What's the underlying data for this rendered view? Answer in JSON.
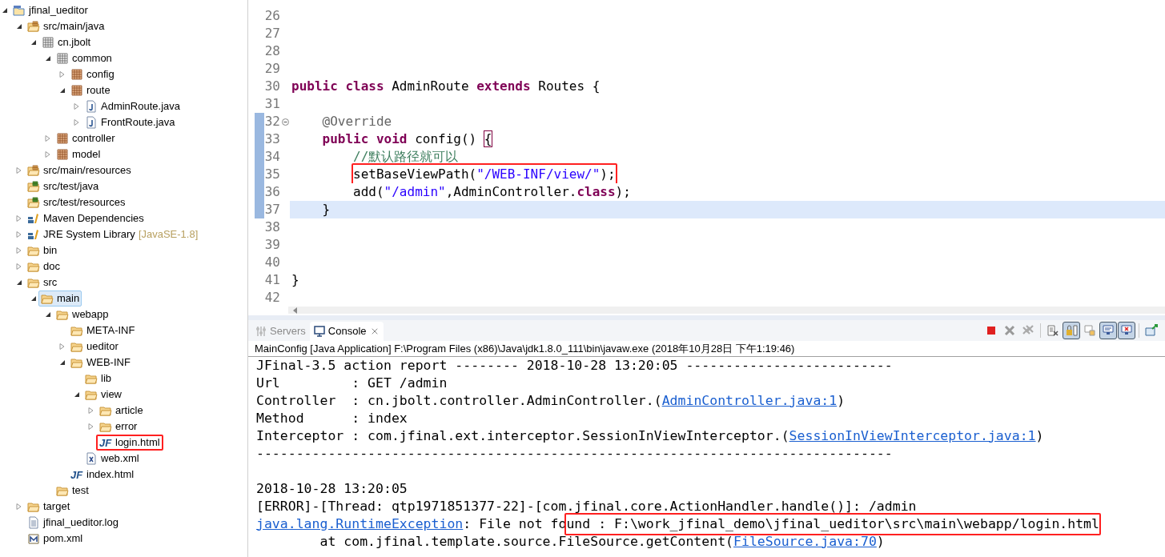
{
  "project_tree": [
    {
      "label": "jfinal_ueditor",
      "kind": "project",
      "expanded": true,
      "selected": false,
      "children": [
        {
          "label": "src/main/java",
          "kind": "source-folder",
          "expanded": true,
          "selected": false,
          "children": [
            {
              "label": "cn.jbolt",
              "kind": "package-empty",
              "expanded": true,
              "selected": false,
              "children": [
                {
                  "label": "common",
                  "kind": "package-empty",
                  "expanded": true,
                  "selected": false,
                  "children": [
                    {
                      "label": "config",
                      "kind": "package",
                      "expanded": false,
                      "selected": false
                    },
                    {
                      "label": "route",
                      "kind": "package",
                      "expanded": true,
                      "selected": false,
                      "children": [
                        {
                          "label": "AdminRoute.java",
                          "kind": "java",
                          "expanded": false,
                          "selected": false
                        },
                        {
                          "label": "FrontRoute.java",
                          "kind": "java",
                          "expanded": false,
                          "selected": false
                        }
                      ]
                    }
                  ]
                },
                {
                  "label": "controller",
                  "kind": "package",
                  "expanded": false,
                  "selected": false
                },
                {
                  "label": "model",
                  "kind": "package",
                  "expanded": false,
                  "selected": false
                }
              ]
            }
          ]
        },
        {
          "label": "src/main/resources",
          "kind": "source-folder",
          "expanded": false,
          "selected": false
        },
        {
          "label": "src/test/java",
          "kind": "test-folder",
          "selected": false
        },
        {
          "label": "src/test/resources",
          "kind": "test-folder",
          "selected": false
        },
        {
          "label": "Maven Dependencies",
          "kind": "library",
          "expanded": false,
          "selected": false
        },
        {
          "label": "JRE System Library",
          "decoration": "[JavaSE-1.8]",
          "kind": "library",
          "expanded": false,
          "selected": false
        },
        {
          "label": "bin",
          "kind": "folder",
          "expanded": false,
          "selected": false
        },
        {
          "label": "doc",
          "kind": "folder",
          "expanded": false,
          "selected": false
        },
        {
          "label": "src",
          "kind": "folder",
          "expanded": true,
          "selected": false,
          "children": [
            {
              "label": "main",
              "kind": "folder",
              "expanded": true,
              "selected": true,
              "children": [
                {
                  "label": "webapp",
                  "kind": "folder",
                  "expanded": true,
                  "selected": false,
                  "children": [
                    {
                      "label": "META-INF",
                      "kind": "folder",
                      "selected": false
                    },
                    {
                      "label": "ueditor",
                      "kind": "folder",
                      "expanded": false,
                      "selected": false
                    },
                    {
                      "label": "WEB-INF",
                      "kind": "folder",
                      "expanded": true,
                      "selected": false,
                      "children": [
                        {
                          "label": "lib",
                          "kind": "folder",
                          "selected": false
                        },
                        {
                          "label": "view",
                          "kind": "folder",
                          "expanded": true,
                          "selected": false,
                          "children": [
                            {
                              "label": "article",
                              "kind": "folder",
                              "expanded": false,
                              "selected": false
                            },
                            {
                              "label": "error",
                              "kind": "folder",
                              "expanded": false,
                              "selected": false
                            },
                            {
                              "label": "login.html",
                              "kind": "jf",
                              "icon_text": "JF",
                              "selected": false,
                              "boxed": true
                            }
                          ]
                        },
                        {
                          "label": "web.xml",
                          "kind": "xml",
                          "selected": false
                        }
                      ]
                    },
                    {
                      "label": "index.html",
                      "kind": "jf",
                      "icon_text": "JF",
                      "selected": false
                    }
                  ]
                },
                {
                  "label": "test",
                  "kind": "folder",
                  "selected": false
                }
              ]
            }
          ]
        },
        {
          "label": "target",
          "kind": "folder",
          "expanded": false,
          "selected": false
        },
        {
          "label": "jfinal_ueditor.log",
          "kind": "text-file",
          "selected": false
        },
        {
          "label": "pom.xml",
          "kind": "maven-file",
          "selected": false
        }
      ]
    }
  ],
  "editor": {
    "lines": [
      {
        "number": "26",
        "current": false,
        "changed": false
      },
      {
        "number": "27",
        "current": false,
        "changed": false
      },
      {
        "number": "28",
        "current": false,
        "changed": false
      },
      {
        "number": "29",
        "current": false,
        "changed": false
      },
      {
        "number": "30",
        "current": false,
        "changed": false,
        "tokens": [
          {
            "kind": "keyword",
            "text": "public class "
          },
          {
            "kind": "plain",
            "text": "AdminRoute "
          },
          {
            "kind": "keyword",
            "text": "extends "
          },
          {
            "kind": "plain",
            "text": "Routes {"
          }
        ]
      },
      {
        "number": "31",
        "current": false,
        "changed": false
      },
      {
        "number": "32",
        "current": false,
        "changed": true,
        "folded": false,
        "tokens": [
          {
            "kind": "annotation",
            "text": "    @Override"
          }
        ]
      },
      {
        "number": "33",
        "current": false,
        "changed": true,
        "tokens": [
          {
            "kind": "keyword",
            "text": "    public void "
          },
          {
            "kind": "plain",
            "text": "config() "
          },
          {
            "kind": "matched",
            "text": "{"
          }
        ]
      },
      {
        "number": "34",
        "current": false,
        "changed": true,
        "tokens": [
          {
            "kind": "comment",
            "text": "        //默认路径就可以"
          }
        ]
      },
      {
        "number": "35",
        "current": false,
        "changed": true,
        "tokens": [
          {
            "kind": "plain",
            "text": "setBaseViewPath(",
            "boxed": true
          },
          {
            "kind": "string",
            "text": "\"/WEB-INF/view/\"",
            "boxed": true
          },
          {
            "kind": "plain",
            "text": ");",
            "boxed": true
          }
        ]
      },
      {
        "number": "36",
        "current": false,
        "changed": true,
        "tokens": [
          {
            "kind": "plain",
            "text": "        add("
          },
          {
            "kind": "string",
            "text": "\"/admin\""
          },
          {
            "kind": "plain",
            "text": ",AdminController."
          },
          {
            "kind": "keyword",
            "text": "class"
          },
          {
            "kind": "plain",
            "text": ");"
          }
        ]
      },
      {
        "number": "37",
        "current": true,
        "changed": true,
        "tokens": [
          {
            "kind": "plain",
            "text": "    }"
          }
        ]
      },
      {
        "number": "38",
        "current": false,
        "changed": false
      },
      {
        "number": "39",
        "current": false,
        "changed": false
      },
      {
        "number": "40",
        "current": false,
        "changed": false
      },
      {
        "number": "41",
        "current": false,
        "changed": false,
        "tokens": [
          {
            "kind": "plain",
            "text": "}"
          }
        ]
      },
      {
        "number": "42",
        "current": false,
        "changed": false
      }
    ]
  },
  "console": {
    "tabs": [
      {
        "label": "Servers",
        "kind": "servers",
        "selected": false,
        "closable": false
      },
      {
        "label": "Console",
        "kind": "console",
        "selected": true,
        "closable": true
      }
    ],
    "toolbar": [
      {
        "kind": "terminate",
        "pressed": false
      },
      {
        "kind": "remove",
        "pressed": false
      },
      {
        "kind": "remove-all",
        "pressed": false
      },
      {
        "kind": "separator"
      },
      {
        "kind": "clear",
        "pressed": false
      },
      {
        "kind": "scroll-lock",
        "pressed": true
      },
      {
        "kind": "word-wrap",
        "pressed": false
      },
      {
        "kind": "show-stdout",
        "pressed": true
      },
      {
        "kind": "show-stderr",
        "pressed": true
      },
      {
        "kind": "separator"
      },
      {
        "kind": "pin",
        "pressed": false
      }
    ],
    "process": "MainConfig [Java Application] F:\\Program Files (x86)\\Java\\jdk1.8.0_111\\bin\\javaw.exe (2018年10月28日 下午1:19:46)",
    "lines": [
      {
        "kind": "text",
        "segments": [
          {
            "kind": "plain",
            "text": "JFinal-3.5 action report -------- 2018-10-28 13:20:05 --------------------------"
          }
        ]
      },
      {
        "kind": "text",
        "segments": [
          {
            "kind": "plain",
            "text": "Url         : GET /admin"
          }
        ]
      },
      {
        "kind": "text",
        "segments": [
          {
            "kind": "plain",
            "text": "Controller  : cn.jbolt.controller.AdminController.("
          },
          {
            "kind": "link",
            "text": "AdminController.java:1"
          },
          {
            "kind": "plain",
            "text": ")"
          }
        ]
      },
      {
        "kind": "text",
        "segments": [
          {
            "kind": "plain",
            "text": "Method      : index"
          }
        ]
      },
      {
        "kind": "text",
        "segments": [
          {
            "kind": "plain",
            "text": "Interceptor : com.jfinal.ext.interceptor.SessionInViewInterceptor.("
          },
          {
            "kind": "link",
            "text": "SessionInViewInterceptor.java:1"
          },
          {
            "kind": "plain",
            "text": ")"
          }
        ]
      },
      {
        "kind": "text",
        "segments": [
          {
            "kind": "plain",
            "text": "--------------------------------------------------------------------------------"
          }
        ]
      },
      {
        "kind": "blank"
      },
      {
        "kind": "text",
        "segments": [
          {
            "kind": "plain",
            "text": "2018-10-28 13:20:05"
          }
        ]
      },
      {
        "kind": "text",
        "segments": [
          {
            "kind": "plain",
            "text": "[ERROR]-[Thread: qtp1971851377-22]-[com.jfinal.core.ActionHandler.handle()]: /admin"
          }
        ]
      },
      {
        "kind": "text",
        "segments": [
          {
            "kind": "link",
            "text": "java.lang.RuntimeException"
          },
          {
            "kind": "plain",
            "text": ": File not fo"
          },
          {
            "kind": "plain",
            "text": "und : F:\\work_jfinal_demo\\jfinal_ueditor\\src\\main\\webapp/login.html",
            "boxed": true
          }
        ]
      },
      {
        "kind": "text",
        "segments": [
          {
            "kind": "plain",
            "text": "        at com.jfinal.template.source.FileSource.getContent("
          },
          {
            "kind": "link",
            "text": "FileSource.java:70"
          },
          {
            "kind": "plain",
            "text": ")"
          }
        ]
      }
    ]
  }
}
